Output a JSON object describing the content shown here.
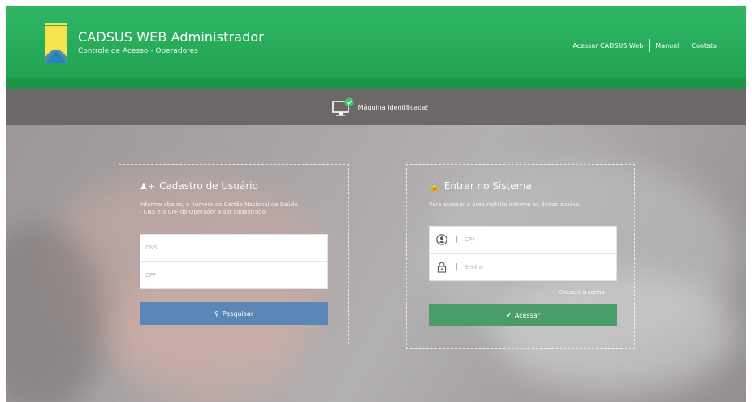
{
  "header": {
    "title": "CADSUS WEB Administrador",
    "subtitle": "Controle de Acesso - Operadores",
    "nav": [
      "Acessar CADSUS Web",
      "Manual",
      "Contato"
    ],
    "color": "#27ae5e"
  },
  "status_bar": {
    "icon": "monitor-check-icon",
    "text": "Máquina identificada!"
  },
  "register": {
    "icon": "add-user-icon",
    "title": "Cadastro de Usuário",
    "description_line1": "Informe abaixo, o número do Cartão Nacional de Saúde",
    "description_line2": "- CNS e o CPF do Operador a ser cadastrado.",
    "cns_placeholder": "CNS",
    "cpf_placeholder": "CPF",
    "button_label": "Pesquisar",
    "button_icon": "search-icon",
    "button_color": "#5a86b8"
  },
  "login": {
    "icon": "lock-icon",
    "title": "Entrar no Sistema",
    "description": "Para acessar a área restrita informe os dados abaixo:",
    "cpf_placeholder": "CPF",
    "password_placeholder": "Senha",
    "separator": "|",
    "forgot_password": "Esqueci a senha",
    "button_label": "Acessar",
    "button_icon": "check-icon",
    "button_color": "#4b9d68"
  }
}
